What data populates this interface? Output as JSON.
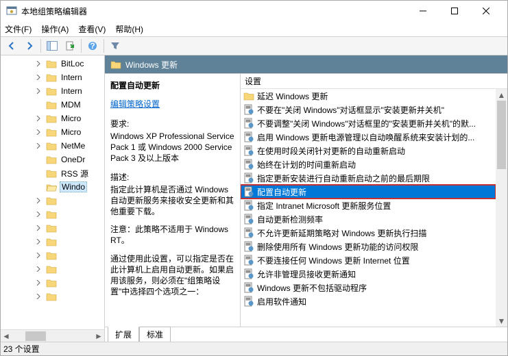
{
  "window": {
    "title": "本地组策略编辑器"
  },
  "menu": {
    "file": "文件(F)",
    "action": "操作(A)",
    "view": "查看(V)",
    "help": "帮助(H)"
  },
  "tree": {
    "items": [
      {
        "label": "BitLoc",
        "expandable": true
      },
      {
        "label": "Intern",
        "expandable": true
      },
      {
        "label": "Intern",
        "expandable": true
      },
      {
        "label": "MDM",
        "expandable": false
      },
      {
        "label": "Micro",
        "expandable": true
      },
      {
        "label": "Micro",
        "expandable": true
      },
      {
        "label": "NetMe",
        "expandable": true
      },
      {
        "label": "OneDr",
        "expandable": false
      },
      {
        "label": "RSS 源",
        "expandable": false
      },
      {
        "label": "Windo",
        "expandable": false,
        "selected": true,
        "open": true
      }
    ],
    "empty_rows": 18
  },
  "content": {
    "header": "Windows 更新",
    "desc": {
      "title": "配置自动更新",
      "edit_link": "编辑策略设置",
      "req_label": "要求:",
      "req_text": "Windows XP Professional Service Pack 1 或 Windows 2000 Service Pack 3 及以上版本",
      "desc_label": "描述:",
      "desc_text": "指定此计算机是否通过 Windows 自动更新服务来接收安全更新和其他重要下载。",
      "note_text": "注意：此策略不适用于 Windows RT。",
      "para_text": "通过使用此设置，可以指定是否在此计算机上启用自动更新。如果启用该服务，则必须在\"组策略设置\"中选择四个选项之一："
    },
    "list": {
      "col_header": "设置",
      "items": [
        {
          "label": "延迟 Windows 更新",
          "type": "folder"
        },
        {
          "label": "不要在\"关闭 Windows\"对话框显示\"安装更新并关机\"",
          "type": "policy"
        },
        {
          "label": "不要调整\"关闭 Windows\"对话框里的\"安装更新并关机\"的默...",
          "type": "policy"
        },
        {
          "label": "启用 Windows 更新电源管理以自动唤醒系统来安装计划的...",
          "type": "policy"
        },
        {
          "label": "在使用时段关闭针对更新的自动重新启动",
          "type": "policy"
        },
        {
          "label": "始终在计划的时间重新启动",
          "type": "policy"
        },
        {
          "label": "指定更新安装进行自动重新启动之前的最后期限",
          "type": "policy"
        },
        {
          "label": "配置自动更新",
          "type": "policy",
          "selected": true
        },
        {
          "label": "指定 Intranet Microsoft 更新服务位置",
          "type": "policy"
        },
        {
          "label": "自动更新检测频率",
          "type": "policy"
        },
        {
          "label": "不允许更新延期策略对 Windows 更新执行扫描",
          "type": "policy"
        },
        {
          "label": "删除使用所有 Windows 更新功能的访问权限",
          "type": "policy"
        },
        {
          "label": "不要连接任何 Windows 更新 Internet 位置",
          "type": "policy"
        },
        {
          "label": "允许非管理员接收更新通知",
          "type": "policy"
        },
        {
          "label": "Windows 更新不包括驱动程序",
          "type": "policy"
        },
        {
          "label": "启用软件通知",
          "type": "policy"
        }
      ]
    },
    "tabs": {
      "extended": "扩展",
      "standard": "标准"
    }
  },
  "status": {
    "text": "23 个设置"
  }
}
